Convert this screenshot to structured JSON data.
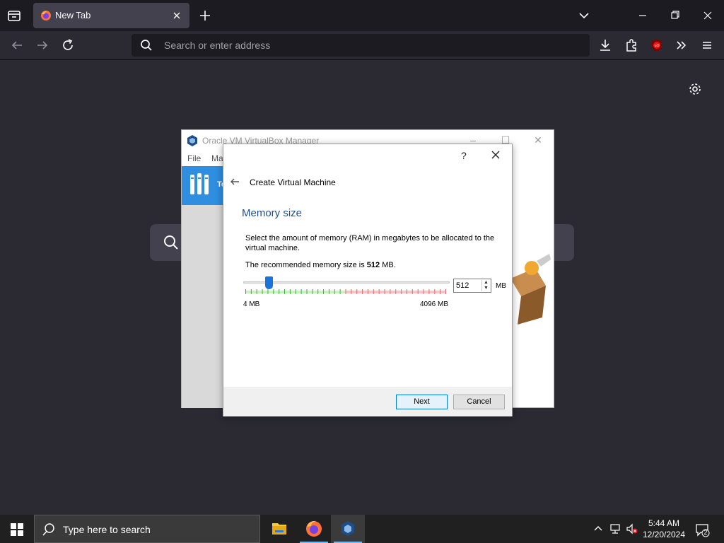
{
  "browser": {
    "tab_title": "New Tab",
    "url_placeholder": "Search or enter address"
  },
  "vbox_manager": {
    "title": "Oracle VM VirtualBox Manager",
    "menu": [
      "File",
      "Ma"
    ],
    "toolbox_label_partial": "To"
  },
  "dialog": {
    "help": "?",
    "wizard_title": "Create Virtual Machine",
    "page_title": "Memory size",
    "description": "Select the amount of memory (RAM) in megabytes to be allocated to the virtual machine.",
    "recommend_prefix": "The recommended memory size is",
    "recommend_value": "512",
    "recommend_suffix": "MB.",
    "memory_value": "512",
    "unit": "MB",
    "min_label": "4 MB",
    "max_label": "4096 MB",
    "slider_fraction": 0.124,
    "next_label": "Next",
    "cancel_label": "Cancel"
  },
  "taskbar": {
    "search_placeholder": "Type here to search",
    "time": "5:44 AM",
    "date": "12/20/2024",
    "notification_count": "2"
  },
  "colors": {
    "accent": "#0078d7",
    "page_title": "#1f4e8c",
    "slider_handle": "#1a73d9"
  }
}
